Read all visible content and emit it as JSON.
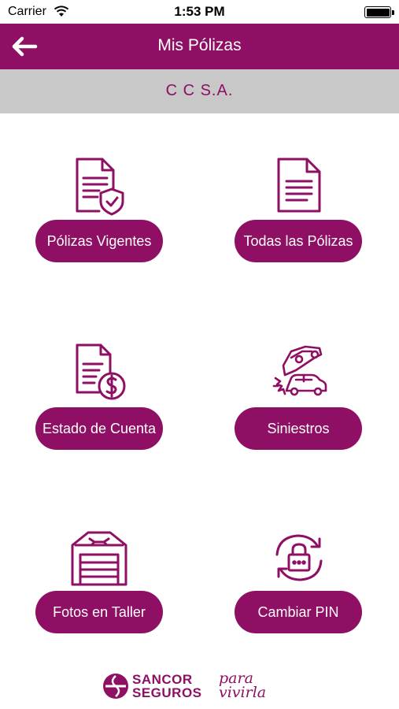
{
  "status_bar": {
    "carrier": "Carrier",
    "time": "1:53 PM"
  },
  "nav": {
    "title": "Mis Pólizas"
  },
  "account": {
    "company": "C  C  S.A."
  },
  "tiles": [
    {
      "label": "Pólizas Vigentes",
      "icon": "document-shield-icon"
    },
    {
      "label": "Todas las Pólizas",
      "icon": "document-icon"
    },
    {
      "label": "Estado de Cuenta",
      "icon": "document-dollar-icon"
    },
    {
      "label": "Siniestros",
      "icon": "car-crash-icon"
    },
    {
      "label": "Fotos en Taller",
      "icon": "garage-icon"
    },
    {
      "label": "Cambiar PIN",
      "icon": "lock-refresh-icon"
    }
  ],
  "footer": {
    "brand_line1": "SANCOR",
    "brand_line2": "SEGUROS",
    "slogan_line1": "para",
    "slogan_line2": "vivirla"
  },
  "colors": {
    "primary": "#8e0f63",
    "subheader": "#c8c8c8"
  }
}
